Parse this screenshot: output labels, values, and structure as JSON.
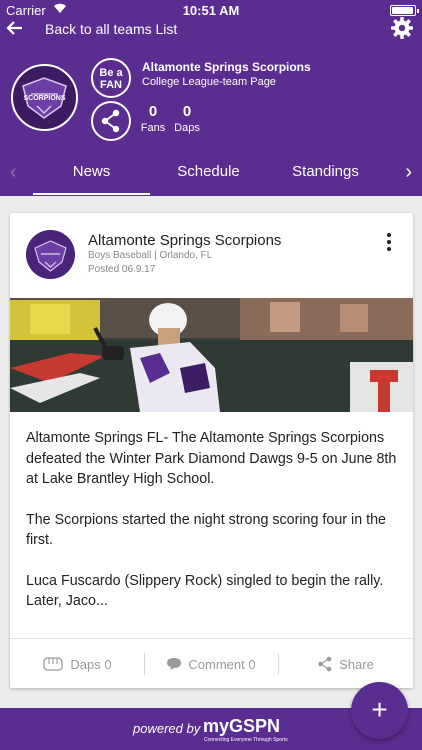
{
  "status_bar": {
    "carrier": "Carrier",
    "time": "10:51 AM"
  },
  "nav": {
    "back_label": "Back to all teams List",
    "back_icon": "arrow-left-icon",
    "settings_icon": "gear-icon"
  },
  "team": {
    "name": "Altamonte Springs Scorpions",
    "subtitle": "College League-team Page",
    "logo_text": "SCORPIONS",
    "be_a_fan_line1": "Be a",
    "be_a_fan_line2": "FAN",
    "fans_count": "0",
    "fans_label": "Fans",
    "daps_count": "0",
    "daps_label": "Daps"
  },
  "tabs": [
    {
      "label": "News",
      "active": true
    },
    {
      "label": "Schedule",
      "active": false
    },
    {
      "label": "Standings",
      "active": false
    }
  ],
  "post": {
    "author": "Altamonte Springs Scorpions",
    "meta": "Boys Baseball | Orlando, FL",
    "date": "Posted 06.9.17",
    "body": [
      "Altamonte Springs FL- The Altamonte Springs Scorpions defeated the Winter Park Diamond Dawgs 9-5 on June 8th at Lake Brantley High School.",
      "The Scorpions started the night strong scoring four in the first.",
      "Luca Fuscardo (Slippery Rock) singled to begin the rally. Later, Jaco..."
    ],
    "actions": {
      "daps": "Daps 0",
      "comment": "Comment 0",
      "share": "Share"
    }
  },
  "footer": {
    "powered_by": "powered by",
    "brand": "myGSPN",
    "tagline": "Connecting Everyone Through Sports"
  },
  "fab": {
    "label": "+"
  },
  "colors": {
    "brand_purple": "#5a2d90",
    "muted_text": "#9a9a9a"
  }
}
